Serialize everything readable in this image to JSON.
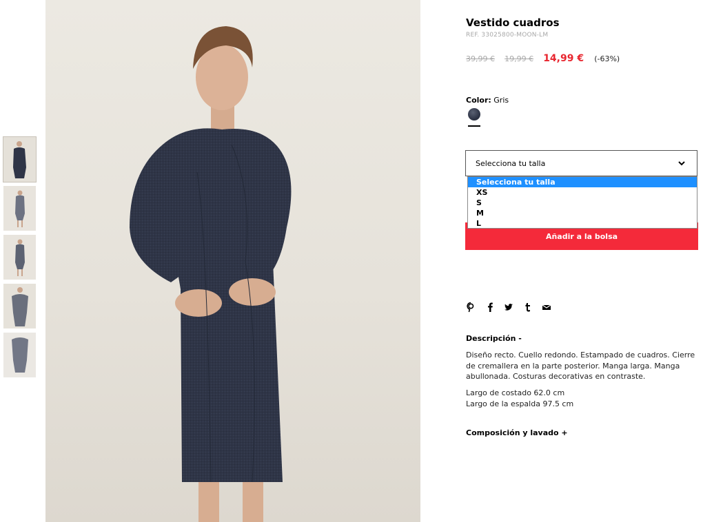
{
  "product": {
    "title": "Vestido cuadros",
    "ref": "REF. 33025800-MOON-LM",
    "old_price_1": "39,99 €",
    "old_price_2": "19,99 €",
    "price": "14,99 €",
    "discount": "(-63%)"
  },
  "color": {
    "label": "Color:",
    "value": "Gris",
    "swatch_hex": "#2f3547"
  },
  "size_select": {
    "selected": "Selecciona tu talla",
    "options": [
      "Selecciona tu talla",
      "XS",
      "S",
      "M",
      "L"
    ]
  },
  "add_to_bag": "Añadir a la bolsa",
  "share_icons": [
    "pinterest-icon",
    "facebook-icon",
    "twitter-icon",
    "tumblr-icon",
    "mail-icon"
  ],
  "description": {
    "heading": "Descripción -",
    "text": "Diseño recto. Cuello redondo. Estampado de cuadros. Cierre de cremallera en la parte posterior. Manga larga. Manga abullonada. Costuras decorativas en contraste.",
    "measure_1": "Largo de costado 62.0 cm",
    "measure_2": "Largo de la espalda 97.5 cm"
  },
  "composition": {
    "heading": "Composición y lavado +"
  },
  "colors": {
    "accent": "#f42a3a",
    "sale_price": "#e8262f",
    "highlight": "#1e90ff",
    "dress": "#2f3547",
    "background": "#e8e4dc"
  }
}
